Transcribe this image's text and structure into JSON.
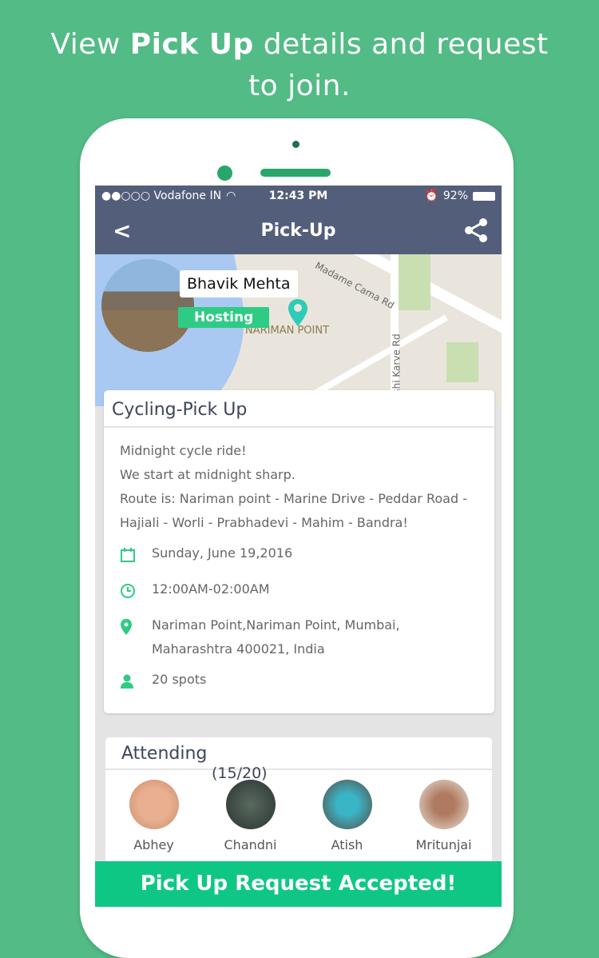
{
  "headline": {
    "line1_pre": "View ",
    "line1_bold": "Pick Up",
    "line1_post": " details and request",
    "line2": "to join."
  },
  "status_bar": {
    "carrier": "●●○○○ Vodafone IN",
    "time": "12:43 PM",
    "battery": "92%"
  },
  "nav": {
    "title": "Pick-Up",
    "back_icon": "chevron-left-icon",
    "share_icon": "share-icon"
  },
  "map": {
    "host_name": "Bhavik Mehta",
    "host_badge": "Hosting",
    "labels": [
      "Madame Cama Rd",
      "NARIMAN POINT",
      "shi Karve Rd"
    ],
    "pin_color": "#2ecbb8"
  },
  "event": {
    "title": "Cycling-Pick Up",
    "description": [
      "Midnight cycle ride!",
      "We start at midnight sharp.",
      "Route is: Nariman point - Marine Drive - Peddar Road - Hajiali - Worli - Prabhadevi - Mahim - Bandra!"
    ],
    "date": "Sunday, June 19,2016",
    "time": "12:00AM-02:00AM",
    "location": "Nariman Point,Nariman Point, Mumbai, Maharashtra 400021, India",
    "spots": "20 spots"
  },
  "attending": {
    "title": "Attending",
    "count": "(15/20)",
    "people": [
      {
        "name": "Abhey"
      },
      {
        "name": "Chandni"
      },
      {
        "name": "Atish"
      },
      {
        "name": "Mritunjai"
      }
    ]
  },
  "action": {
    "label": "Pick Up Request Accepted!"
  },
  "colors": {
    "background": "#52bb86",
    "nav": "#535f7a",
    "accent": "#0fc784"
  }
}
